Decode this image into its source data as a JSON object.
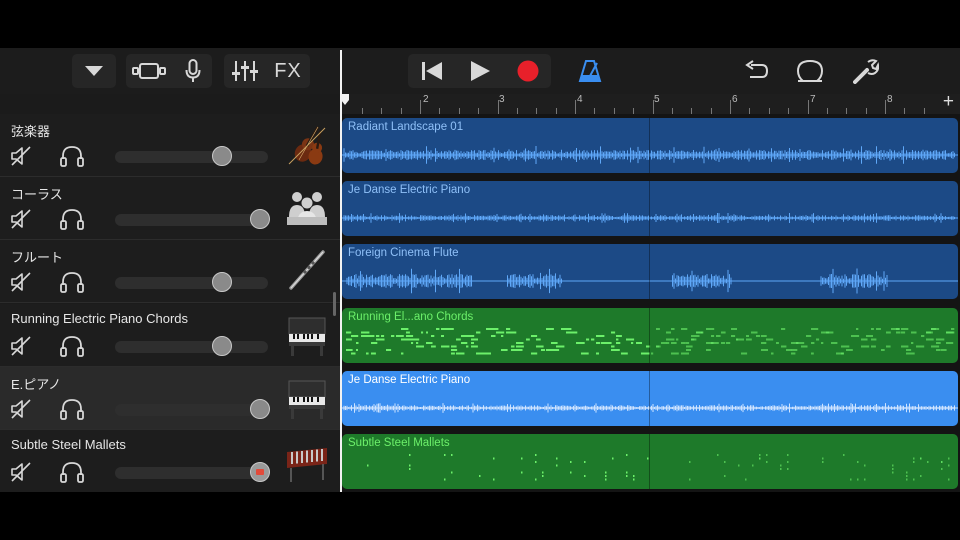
{
  "toolbar": {
    "fx_label": "FX",
    "icons": [
      "chevron-down-icon",
      "tracks-view-icon",
      "microphone-icon",
      "mixer-icon",
      "fx-icon",
      "go-to-start-icon",
      "play-icon",
      "record-icon",
      "metronome-icon",
      "undo-icon",
      "loop-browser-icon",
      "settings-wrench-icon"
    ],
    "record_color": "#e8202a",
    "metronome_color": "#3a8ef0"
  },
  "ruler": {
    "bar_numbers": [
      "2",
      "3",
      "4",
      "5",
      "6",
      "7",
      "8"
    ],
    "add_label": "+"
  },
  "tracks": [
    {
      "name": "弦楽器",
      "volume": 0.7,
      "instrument_icon": "strings-icon",
      "region": {
        "name": "Radiant Landscape 01",
        "kind": "audio",
        "selected": false
      }
    },
    {
      "name": "コーラス",
      "volume": 0.95,
      "instrument_icon": "chorus-icon",
      "region": {
        "name": "Je Danse Electric Piano",
        "kind": "audio",
        "selected": false
      }
    },
    {
      "name": "フルート",
      "volume": 0.7,
      "instrument_icon": "flute-icon",
      "region": {
        "name": "Foreign Cinema Flute",
        "kind": "audio",
        "selected": false
      }
    },
    {
      "name": "Running Electric Piano Chords",
      "volume": 0.7,
      "instrument_icon": "electric-piano-icon",
      "region": {
        "name": "Running El...ano Chords",
        "kind": "midi",
        "selected": false
      }
    },
    {
      "name": "E.ピアノ",
      "volume": 0.95,
      "instrument_icon": "electric-piano-icon",
      "region": {
        "name": "Je Danse Electric Piano",
        "kind": "audio",
        "selected": true
      }
    },
    {
      "name": "Subtle Steel Mallets",
      "volume": 0.95,
      "instrument_icon": "mallets-icon",
      "record_enabled": true,
      "region": {
        "name": "Subtle Steel Mallets",
        "kind": "midi",
        "selected": false
      }
    }
  ],
  "colors": {
    "audio_region": "#1c4a86",
    "audio_region_selected": "#3a8ef0",
    "midi_region": "#1e7a2a",
    "midi_notes": "#6cf06a"
  }
}
